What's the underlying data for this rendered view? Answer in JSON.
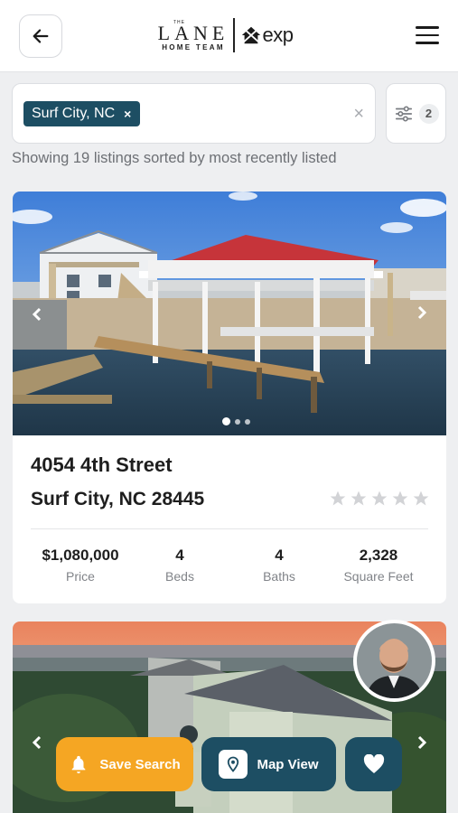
{
  "header": {
    "logo_the": "THE",
    "logo_lane": "LANE",
    "logo_team": "HOME TEAM",
    "logo_exp": "exp"
  },
  "search": {
    "chip_label": "Surf City, NC",
    "chip_remove": "×",
    "clear": "×",
    "filter_count": "2"
  },
  "results_text": "Showing 19 listings sorted by most recently listed",
  "listings": [
    {
      "address": "4054 4th Street",
      "city": "Surf City, NC 28445",
      "price": "$1,080,000",
      "price_label": "Price",
      "beds": "4",
      "beds_label": "Beds",
      "baths": "4",
      "baths_label": "Baths",
      "sqft": "2,328",
      "sqft_label": "Square Feet",
      "rating": 0,
      "photo_count": 3,
      "active_photo": 1
    }
  ],
  "actions": {
    "save_search": "Save Search",
    "map_view": "Map View"
  },
  "colors": {
    "brand": "#1d4e63",
    "accent": "#f5a623"
  }
}
